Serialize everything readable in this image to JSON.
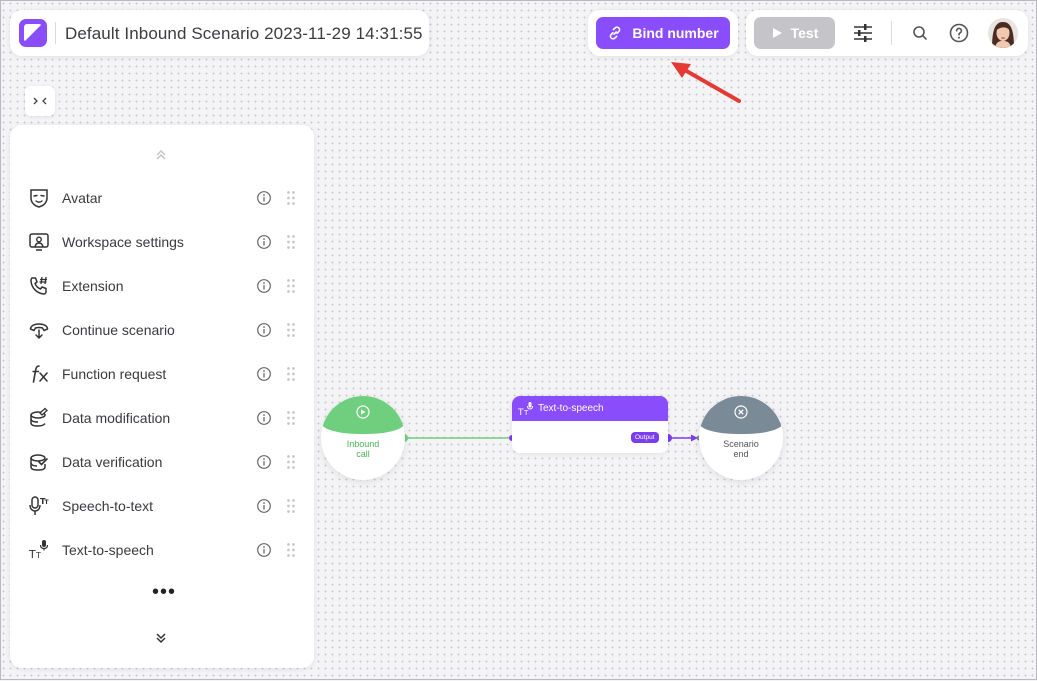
{
  "header": {
    "title": "Default Inbound Scenario 2023-11-29 14:31:55",
    "bind_label": "Bind number",
    "test_label": "Test"
  },
  "sidebar": {
    "items": [
      {
        "label": "Avatar",
        "icon": "avatar-icon"
      },
      {
        "label": "Workspace settings",
        "icon": "workspace-icon"
      },
      {
        "label": "Extension",
        "icon": "extension-icon"
      },
      {
        "label": "Continue scenario",
        "icon": "continue-icon"
      },
      {
        "label": "Function request",
        "icon": "function-icon"
      },
      {
        "label": "Data modification",
        "icon": "data-modification-icon"
      },
      {
        "label": "Data verification",
        "icon": "data-verification-icon"
      },
      {
        "label": "Speech-to-text",
        "icon": "speech-to-text-icon"
      },
      {
        "label": "Text-to-speech",
        "icon": "text-to-speech-icon"
      }
    ],
    "more": "•••"
  },
  "flow": {
    "start": {
      "line1": "Inbound",
      "line2": "call"
    },
    "tts": {
      "title": "Text-to-speech",
      "output": "Output"
    },
    "end": {
      "line1": "Scenario",
      "line2": "end"
    }
  },
  "colors": {
    "accent": "#8a4dfb",
    "start_green": "#6fcf7f",
    "end_gray": "#7a8a96",
    "annotation_arrow": "#e53935"
  }
}
